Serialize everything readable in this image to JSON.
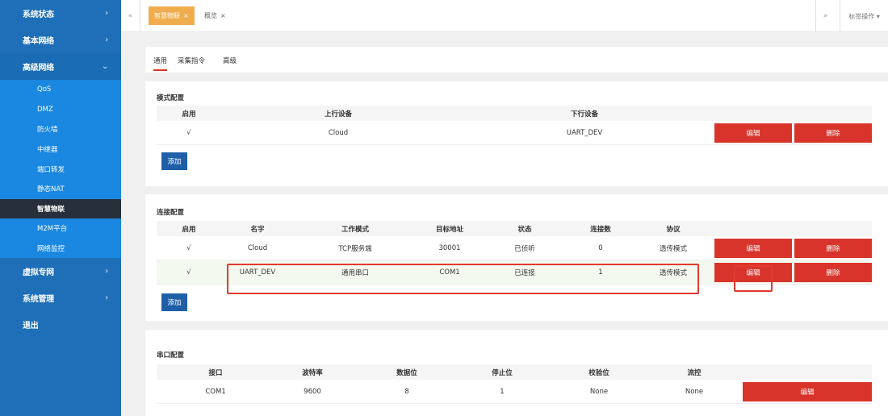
{
  "sidebar": {
    "top": [
      {
        "label": "系统状态",
        "chevron": "›"
      },
      {
        "label": "基本网络",
        "chevron": "›"
      },
      {
        "label": "高级网络",
        "chevron": "⌄"
      }
    ],
    "sub": [
      "QoS",
      "DMZ",
      "防火墙",
      "中继器",
      "端口转发",
      "静态NAT",
      "智慧物联",
      "M2M平台",
      "网络监控"
    ],
    "bottom": [
      {
        "label": "虚拟专网",
        "chevron": "›"
      },
      {
        "label": "系统管理",
        "chevron": "›"
      },
      {
        "label": "退出",
        "chevron": ""
      }
    ]
  },
  "tabbar": {
    "left_arrow": "«",
    "right_arrow": "»",
    "active_tab": "智慧物联",
    "inactive_tab": "概览",
    "close": "×",
    "ops": "标签操作 ▾"
  },
  "subtabs": [
    "通用",
    "采集指令",
    "高级"
  ],
  "mode_config": {
    "title": "模式配置",
    "headers": [
      "启用",
      "上行设备",
      "下行设备"
    ],
    "row": {
      "enabled": "√",
      "up": "Cloud",
      "down": "UART_DEV"
    },
    "edit": "编辑",
    "delete": "删除",
    "add": "添加"
  },
  "conn_config": {
    "title": "连接配置",
    "headers": [
      "启用",
      "名字",
      "工作模式",
      "目标地址",
      "状态",
      "连接数",
      "协议"
    ],
    "rows": [
      {
        "enabled": "√",
        "name": "Cloud",
        "mode": "TCP服务端",
        "target": "30001",
        "status": "已侦听",
        "count": "0",
        "protocol": "透传模式"
      },
      {
        "enabled": "√",
        "name": "UART_DEV",
        "mode": "通用串口",
        "target": "COM1",
        "status": "已连接",
        "count": "1",
        "protocol": "透传模式"
      }
    ],
    "edit": "编辑",
    "delete": "删除",
    "add": "添加"
  },
  "serial_config": {
    "title": "串口配置",
    "headers": [
      "接口",
      "波特率",
      "数据位",
      "停止位",
      "校验位",
      "流控"
    ],
    "row": {
      "port": "COM1",
      "baud": "9600",
      "data": "8",
      "stop": "1",
      "parity": "None",
      "flow": "None"
    },
    "edit": "编辑"
  }
}
